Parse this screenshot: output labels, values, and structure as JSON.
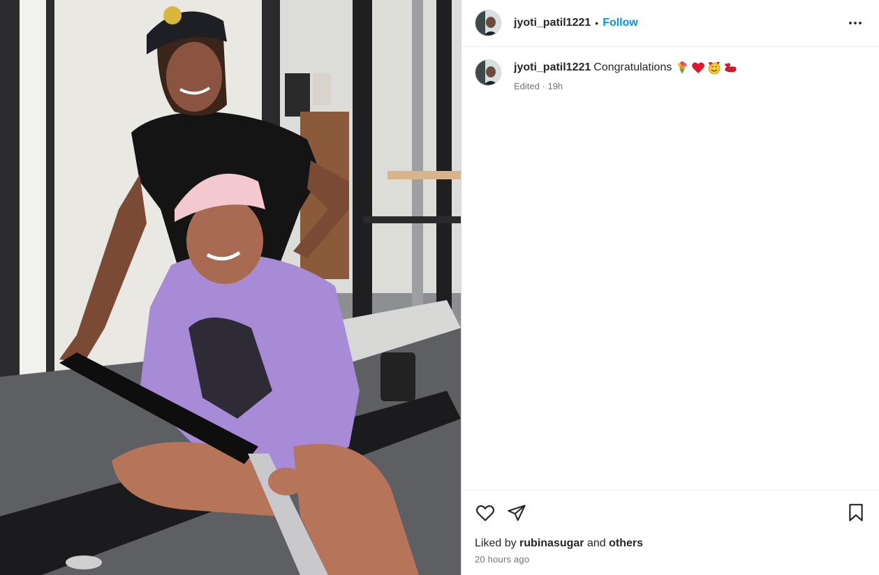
{
  "header": {
    "username": "jyoti_patil1221",
    "separator": "•",
    "follow_label": "Follow"
  },
  "caption": {
    "username": "jyoti_patil1221",
    "text": "Congratulations",
    "emojis": [
      "bouquet-emoji",
      "red-heart-emoji",
      "smiling-face-with-hearts-emoji",
      "hand-with-heart-emoji"
    ],
    "edited_label": "Edited",
    "meta_separator": "·",
    "age": "19h"
  },
  "actions": {
    "like_icon": "heart-outline-icon",
    "share_icon": "paper-plane-icon",
    "save_icon": "bookmark-outline-icon"
  },
  "likes": {
    "prefix": "Liked by",
    "user": "rubinasugar",
    "joiner": "and",
    "others": "others"
  },
  "timestamp": "20 hours ago",
  "colors": {
    "follow": "#0095f6",
    "secondary_text": "#737373",
    "primary_text": "#262626"
  }
}
